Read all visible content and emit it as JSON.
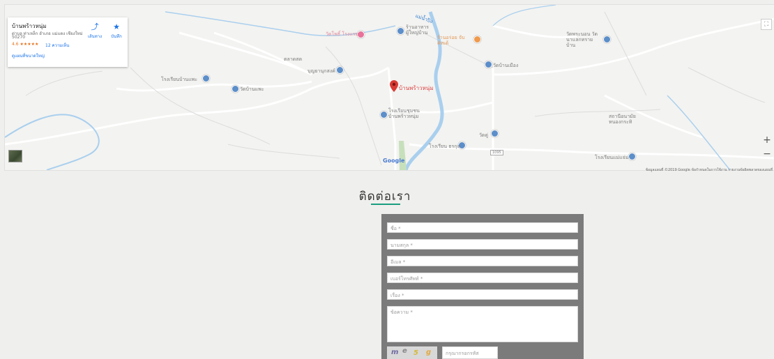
{
  "map": {
    "info_card": {
      "place_name": "บ้านพร้าวหนุ่ม",
      "address_line1": "ต่าบล ท่าเหล็ก อำเภอ แม่แตง เชียงใหม่",
      "address_line2": "50270",
      "rating": "4.6 ★★★★★",
      "reviews": "12 ความเห็น",
      "larger_map_link": "ดูแผนที่ขนาดใหญ่",
      "directions_label": "เส้นทาง",
      "save_label": "บันทึก"
    },
    "labels": {
      "school_left": "โรงเรียนบ้านแพะ",
      "temple_left": "วัดบ้านแพะ",
      "market": "ตลาดสด",
      "temple_center": "บุญยานุกสงค์",
      "school_top": "วัดโพธิ์ โรงแรม",
      "shop_top": "ร้านอาหาร ผู้ใหญ่บ้าน",
      "cafe": "ร้านอร่อย จับคิทเด้",
      "main_pin": "บ้านพร้าวหนุ่ม",
      "school_main": "โรงเรียนชุมชน บ้านพร้าวหนุ่ม",
      "temple_right": "วัดบ้านเมือง",
      "temple_far_right": "วัดพระนอน วัดนาแลกทราย บ้าน",
      "hospital_right": "สถานีอนามัย หนองกระทิ",
      "temple_small": "วัดดู่",
      "school_bottom": "โรงเรียน ธรกุล",
      "school_far_bottom": "โรงเรียนแม่แจ่ม",
      "road_badge": "1095",
      "river": "แม่น้ำปิง"
    },
    "google_logo": "Google",
    "attribution": "ข้อมูลแผนที่ ©2019 Google   ข้อกำหนดในการใช้งาน   รายงานข้อผิดพลาดของแผนที่",
    "zoom_in": "+",
    "zoom_out": "−"
  },
  "contact": {
    "title": "ติดต่อเรา",
    "fields": {
      "name": "ชื่อ *",
      "surname": "นามสกุล *",
      "email": "อีเมล *",
      "phone": "เบอร์โทรศัพท์ *",
      "subject": "เรื่อง *",
      "message": "ข้อความ *"
    },
    "captcha_placeholder": "กรุณากรอกรหัส",
    "captcha_chars": [
      "m",
      "e",
      "5",
      "g"
    ]
  },
  "colors": {
    "accent": "#1a9e80",
    "form_bg": "#7b7b7b",
    "river": "#a9cfee",
    "pin": "#d93a33"
  }
}
